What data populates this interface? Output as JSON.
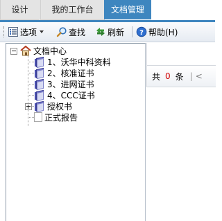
{
  "tabs": [
    {
      "label": "设计",
      "active": false
    },
    {
      "label": "我的工作台",
      "active": false
    },
    {
      "label": "文档管理",
      "active": true
    }
  ],
  "colors": {
    "active_tab": "#3e86bf",
    "count_red": "#d00000"
  },
  "toolbar": {
    "options_label": "选项",
    "find_label": "查找",
    "refresh_label": "刷新",
    "help_label": "帮助(H)"
  },
  "tree": {
    "root": {
      "label": "文档中心",
      "icon": "house-icon",
      "expanded": true
    },
    "items": [
      {
        "label": "1、沃华中科资料",
        "icon": "book-icon"
      },
      {
        "label": "2、核准证书",
        "icon": "book-icon"
      },
      {
        "label": "3、进网证书",
        "icon": "book-icon"
      },
      {
        "label": "4、CCC证书",
        "icon": "book-icon"
      },
      {
        "label": "授权书",
        "icon": "book-icon",
        "expandable": true
      },
      {
        "label": "正式报告",
        "icon": "blank-page-icon"
      }
    ]
  },
  "pager": {
    "prefix": "共",
    "count": "0",
    "suffix": "条",
    "separator": "|",
    "first": "<"
  }
}
